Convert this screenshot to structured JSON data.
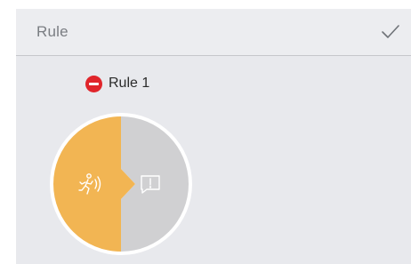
{
  "header": {
    "title": "Rule",
    "confirm_icon": "checkmark-icon"
  },
  "rules": [
    {
      "name": "Rule 1",
      "remove_icon": "minus-circle-icon",
      "trigger_icon": "running-person-motion-icon",
      "action_icon": "alert-message-icon",
      "colors": {
        "trigger": "#f2b553",
        "action": "#d0d0d2",
        "remove": "#e0252b"
      }
    }
  ]
}
